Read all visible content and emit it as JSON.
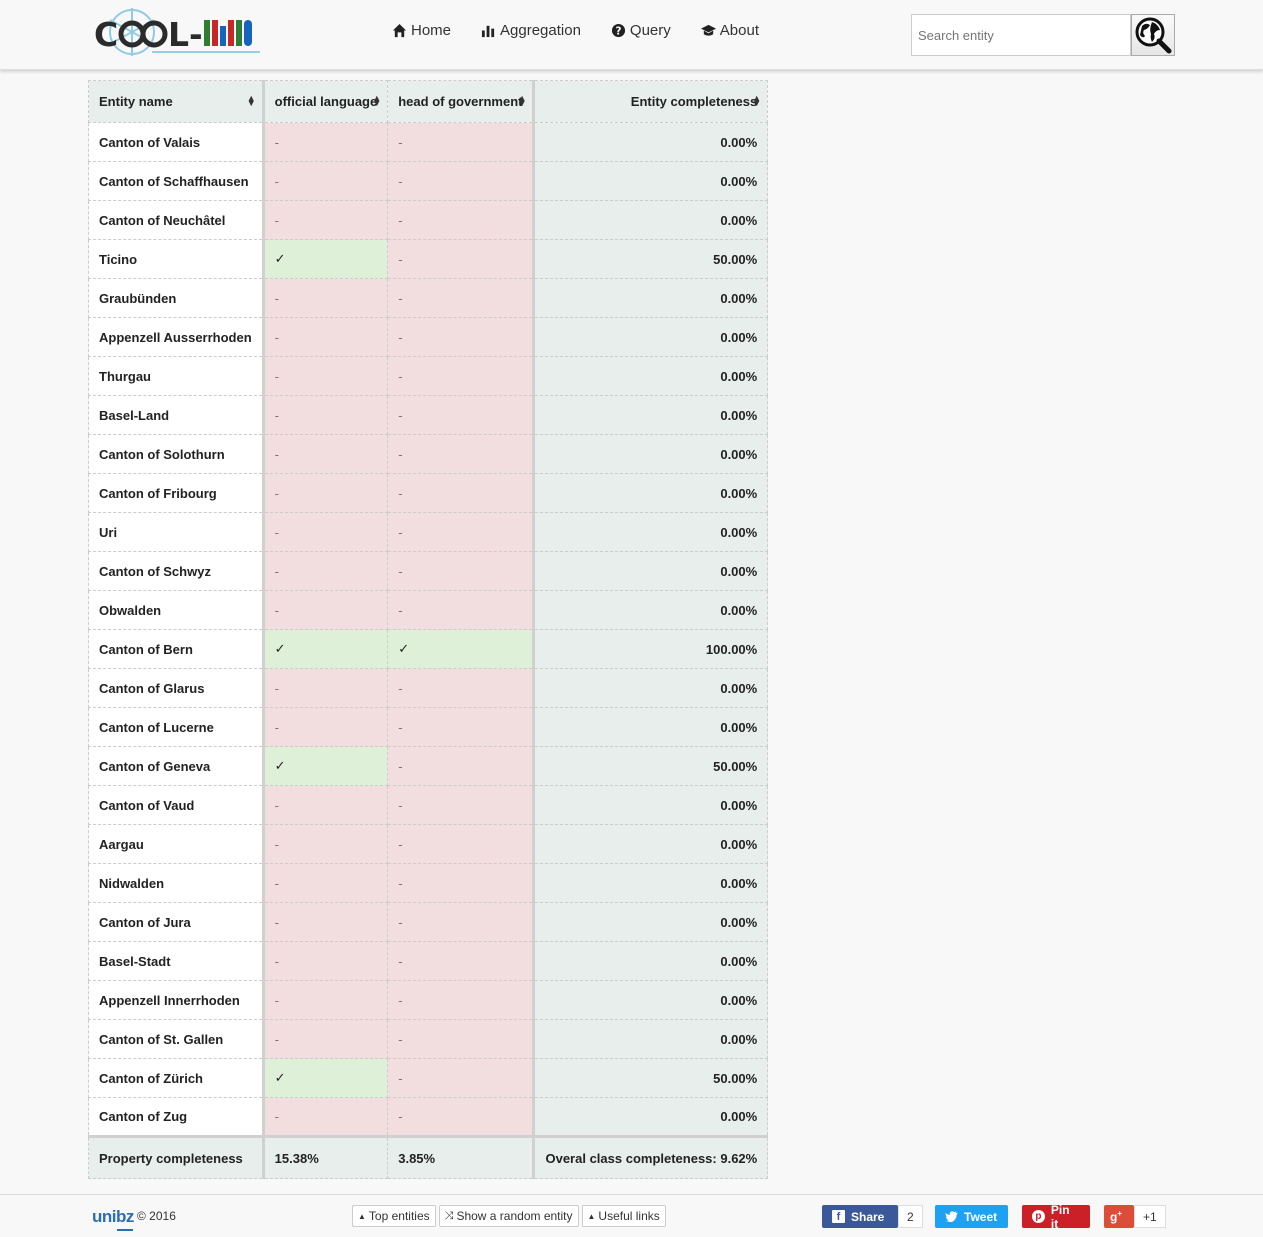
{
  "header": {
    "logo_text": "COOL-WD",
    "nav": [
      {
        "label": "Home",
        "icon": "home-icon"
      },
      {
        "label": "Aggregation",
        "icon": "bar-chart-icon"
      },
      {
        "label": "Query",
        "icon": "question-icon"
      },
      {
        "label": "About",
        "icon": "graduation-cap-icon"
      }
    ],
    "search_placeholder": "Search entity"
  },
  "table": {
    "headers": [
      "Entity name",
      "official language",
      "head of government",
      "Entity completeness"
    ],
    "rows": [
      {
        "name": "Canton of Valais",
        "p1": "-",
        "p2": "-",
        "comp": "0.00%"
      },
      {
        "name": "Canton of Schaffhausen",
        "p1": "-",
        "p2": "-",
        "comp": "0.00%"
      },
      {
        "name": "Canton of Neuchâtel",
        "p1": "-",
        "p2": "-",
        "comp": "0.00%"
      },
      {
        "name": "Ticino",
        "p1": "✓",
        "p2": "-",
        "comp": "50.00%"
      },
      {
        "name": "Graubünden",
        "p1": "-",
        "p2": "-",
        "comp": "0.00%"
      },
      {
        "name": "Appenzell Ausserrhoden",
        "p1": "-",
        "p2": "-",
        "comp": "0.00%"
      },
      {
        "name": "Thurgau",
        "p1": "-",
        "p2": "-",
        "comp": "0.00%"
      },
      {
        "name": "Basel-Land",
        "p1": "-",
        "p2": "-",
        "comp": "0.00%"
      },
      {
        "name": "Canton of Solothurn",
        "p1": "-",
        "p2": "-",
        "comp": "0.00%"
      },
      {
        "name": "Canton of Fribourg",
        "p1": "-",
        "p2": "-",
        "comp": "0.00%"
      },
      {
        "name": "Uri",
        "p1": "-",
        "p2": "-",
        "comp": "0.00%"
      },
      {
        "name": "Canton of Schwyz",
        "p1": "-",
        "p2": "-",
        "comp": "0.00%"
      },
      {
        "name": "Obwalden",
        "p1": "-",
        "p2": "-",
        "comp": "0.00%"
      },
      {
        "name": "Canton of Bern",
        "p1": "✓",
        "p2": "✓",
        "comp": "100.00%"
      },
      {
        "name": "Canton of Glarus",
        "p1": "-",
        "p2": "-",
        "comp": "0.00%"
      },
      {
        "name": "Canton of Lucerne",
        "p1": "-",
        "p2": "-",
        "comp": "0.00%"
      },
      {
        "name": "Canton of Geneva",
        "p1": "✓",
        "p2": "-",
        "comp": "50.00%"
      },
      {
        "name": "Canton of Vaud",
        "p1": "-",
        "p2": "-",
        "comp": "0.00%"
      },
      {
        "name": "Aargau",
        "p1": "-",
        "p2": "-",
        "comp": "0.00%"
      },
      {
        "name": "Nidwalden",
        "p1": "-",
        "p2": "-",
        "comp": "0.00%"
      },
      {
        "name": "Canton of Jura",
        "p1": "-",
        "p2": "-",
        "comp": "0.00%"
      },
      {
        "name": "Basel-Stadt",
        "p1": "-",
        "p2": "-",
        "comp": "0.00%"
      },
      {
        "name": "Appenzell Innerrhoden",
        "p1": "-",
        "p2": "-",
        "comp": "0.00%"
      },
      {
        "name": "Canton of St. Gallen",
        "p1": "-",
        "p2": "-",
        "comp": "0.00%"
      },
      {
        "name": "Canton of Zürich",
        "p1": "✓",
        "p2": "-",
        "comp": "50.00%"
      },
      {
        "name": "Canton of Zug",
        "p1": "-",
        "p2": "-",
        "comp": "0.00%"
      }
    ],
    "footer": {
      "label": "Property completeness",
      "p1": "15.38%",
      "p2": "3.85%",
      "overall": "Overal class completeness: 9.62%"
    }
  },
  "footer": {
    "brand": "unibz",
    "copyright": "© 2016",
    "buttons": [
      "Top entities",
      "Show a random entity",
      "Useful links"
    ],
    "social": {
      "share": "Share",
      "share_count": "2",
      "tweet": "Tweet",
      "pin": "Pin it",
      "gplus_count": "+1"
    }
  },
  "colors": {
    "negative_cell": "#f2dede",
    "positive_cell": "#dff0d8",
    "header_bg": "#e7eeec",
    "facebook": "#3b5998",
    "twitter": "#1da1f2",
    "pinterest": "#cb2027",
    "gplus": "#dd4b39"
  }
}
